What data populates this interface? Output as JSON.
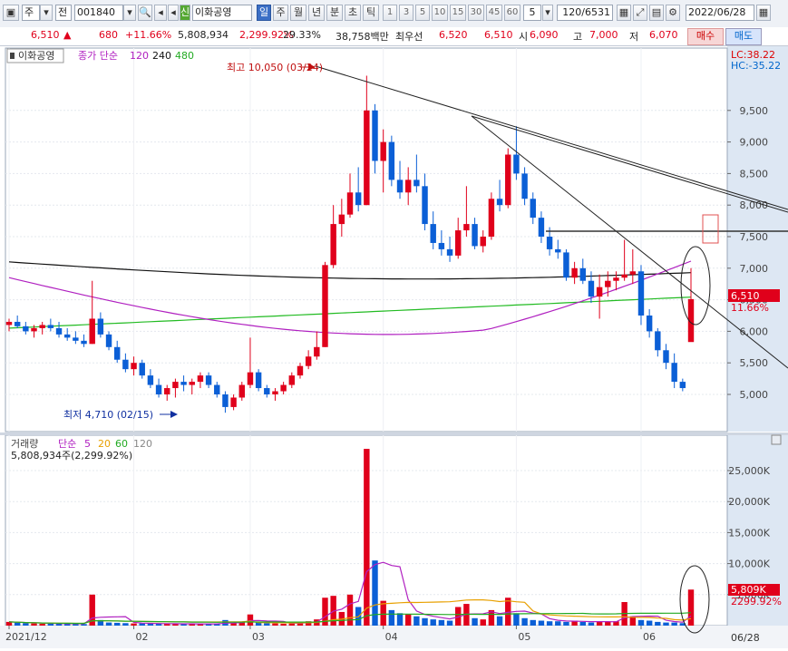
{
  "toolbar": {
    "market_label": "주",
    "jeon_label": "전",
    "code": "001840",
    "stock_badge": "신",
    "stock_name": "이화공영",
    "periods": [
      "일",
      "주",
      "월",
      "년",
      "분",
      "초",
      "틱"
    ],
    "active_period": "일",
    "intervals": [
      "1",
      "3",
      "5",
      "10",
      "15",
      "30",
      "45",
      "60"
    ],
    "interval_value": "5",
    "count": "120/6531",
    "date": "2022/06/28"
  },
  "quote": {
    "price": "6,510",
    "change": "680",
    "change_pct": "+11.66%",
    "volume": "5,808,934",
    "volume_ratio": "2,299.92%",
    "turnover": "29.33%",
    "amount": "38,758백만",
    "priority_label": "최우선",
    "priority_value": "6,520",
    "priority_value2": "6,510",
    "open_label": "시",
    "open": "6,090",
    "high_label": "고",
    "high": "7,000",
    "low_label": "저",
    "low": "6,070",
    "buy_label": "매수",
    "sell_label": "매도"
  },
  "price_panel": {
    "name_label": "이화공영",
    "ma_label": "종가 단순",
    "ma_periods": [
      "120",
      "240",
      "480"
    ],
    "lc": "LC:38.22",
    "hc": "HC:-35.22",
    "high_annotation": "최고 10,050 (03/24)",
    "low_annotation": "최저 4,710 (02/15)",
    "current_price_tag": "6,510",
    "current_pct_tag": "11.66%",
    "y_ticks": [
      "9,500",
      "9,000",
      "8,500",
      "8,000",
      "7,500",
      "7,000",
      "6,500",
      "6,000",
      "5,500",
      "5,000"
    ]
  },
  "volume_panel": {
    "label": "거래량",
    "ma_label": "단순",
    "ma_periods": [
      "5",
      "20",
      "60",
      "120"
    ],
    "today_volume": "5,808,934주(2,299.92%)",
    "volume_tag": "5,809K",
    "ratio_tag": "2299.92%",
    "y_ticks": [
      "25,000K",
      "20,000K",
      "15,000K",
      "10,000K",
      "5,000K"
    ]
  },
  "x_axis": {
    "labels": [
      "2021/12",
      "02",
      "03",
      "04",
      "05",
      "06"
    ],
    "last_date": "06/28"
  },
  "colors": {
    "up": "#e0001b",
    "down": "#0b5fd6",
    "ma120": "#b020c0",
    "ma240": "#22bb22",
    "ma480": "#111111",
    "vol_ma5": "#b020c0",
    "vol_ma20": "#e8a000",
    "vol_ma60": "#22aa22",
    "vol_ma120": "#888888"
  },
  "chart_data": {
    "type": "candlestick",
    "price_axis_range": [
      4500,
      10300
    ],
    "volume_axis_range": [
      0,
      29000
    ],
    "x_labels": [
      "2021/12",
      "02",
      "03",
      "04",
      "05",
      "06"
    ],
    "candles": [
      [
        6100,
        6200,
        6000,
        6150
      ],
      [
        6150,
        6250,
        6050,
        6080
      ],
      [
        6080,
        6150,
        5950,
        6000
      ],
      [
        6000,
        6100,
        5900,
        6050
      ],
      [
        6050,
        6150,
        5950,
        6100
      ],
      [
        6100,
        6200,
        6000,
        6050
      ],
      [
        6050,
        6150,
        5900,
        5950
      ],
      [
        5950,
        6050,
        5850,
        5900
      ],
      [
        5900,
        6000,
        5800,
        5850
      ],
      [
        5850,
        5950,
        5750,
        5800
      ],
      [
        5800,
        6800,
        5800,
        6200
      ],
      [
        6200,
        6300,
        5900,
        5950
      ],
      [
        5950,
        6000,
        5700,
        5750
      ],
      [
        5750,
        5850,
        5500,
        5550
      ],
      [
        5550,
        5650,
        5350,
        5400
      ],
      [
        5400,
        5600,
        5300,
        5500
      ],
      [
        5500,
        5550,
        5250,
        5300
      ],
      [
        5300,
        5400,
        5100,
        5150
      ],
      [
        5150,
        5250,
        4950,
        5000
      ],
      [
        5000,
        5150,
        4900,
        5100
      ],
      [
        5100,
        5250,
        4950,
        5200
      ],
      [
        5200,
        5300,
        5050,
        5150
      ],
      [
        5150,
        5250,
        5000,
        5200
      ],
      [
        5200,
        5350,
        5100,
        5300
      ],
      [
        5300,
        5350,
        5100,
        5150
      ],
      [
        5150,
        5200,
        4950,
        5000
      ],
      [
        5000,
        5050,
        4710,
        4800
      ],
      [
        4800,
        5000,
        4750,
        4950
      ],
      [
        4950,
        5200,
        4900,
        5150
      ],
      [
        5150,
        5900,
        5100,
        5350
      ],
      [
        5350,
        5400,
        5050,
        5100
      ],
      [
        5100,
        5150,
        4950,
        5000
      ],
      [
        5000,
        5100,
        4900,
        5050
      ],
      [
        5050,
        5200,
        5000,
        5150
      ],
      [
        5150,
        5350,
        5100,
        5300
      ],
      [
        5300,
        5500,
        5250,
        5450
      ],
      [
        5450,
        5700,
        5400,
        5600
      ],
      [
        5600,
        6000,
        5550,
        5750
      ],
      [
        5750,
        7100,
        5750,
        7050
      ],
      [
        7050,
        8000,
        7000,
        7700
      ],
      [
        7700,
        8100,
        7500,
        7850
      ],
      [
        7850,
        8500,
        7800,
        8200
      ],
      [
        8200,
        8600,
        7900,
        8000
      ],
      [
        8000,
        10050,
        8000,
        9500
      ],
      [
        9500,
        9600,
        8500,
        8700
      ],
      [
        8700,
        9200,
        8200,
        9000
      ],
      [
        9000,
        9100,
        8300,
        8400
      ],
      [
        8400,
        8700,
        8100,
        8200
      ],
      [
        8200,
        8600,
        8000,
        8400
      ],
      [
        8400,
        8800,
        8200,
        8300
      ],
      [
        8300,
        8500,
        7600,
        7700
      ],
      [
        7700,
        7900,
        7300,
        7400
      ],
      [
        7400,
        7600,
        7200,
        7300
      ],
      [
        7300,
        7500,
        7100,
        7200
      ],
      [
        7200,
        7800,
        7150,
        7600
      ],
      [
        7600,
        8300,
        7500,
        7700
      ],
      [
        7700,
        7800,
        7300,
        7350
      ],
      [
        7350,
        7600,
        7250,
        7500
      ],
      [
        7500,
        8200,
        7450,
        8100
      ],
      [
        8100,
        8400,
        7900,
        8000
      ],
      [
        8000,
        8900,
        7950,
        8800
      ],
      [
        8800,
        9250,
        8400,
        8500
      ],
      [
        8500,
        8600,
        8000,
        8100
      ],
      [
        8100,
        8200,
        7700,
        7800
      ],
      [
        7800,
        7900,
        7400,
        7500
      ],
      [
        7500,
        7650,
        7200,
        7300
      ],
      [
        7300,
        7450,
        7150,
        7250
      ],
      [
        7250,
        7300,
        6800,
        6850
      ],
      [
        6850,
        7100,
        6750,
        7000
      ],
      [
        7000,
        7150,
        6750,
        6800
      ],
      [
        6800,
        6950,
        6450,
        6550
      ],
      [
        6550,
        6900,
        6200,
        6700
      ],
      [
        6700,
        6950,
        6550,
        6800
      ],
      [
        6800,
        6950,
        6650,
        6850
      ],
      [
        6850,
        7450,
        6800,
        6900
      ],
      [
        6900,
        7300,
        6750,
        6950
      ],
      [
        6950,
        7050,
        6100,
        6250
      ],
      [
        6250,
        6350,
        5900,
        6000
      ],
      [
        6000,
        6050,
        5600,
        5700
      ],
      [
        5700,
        5800,
        5400,
        5500
      ],
      [
        5500,
        5650,
        5100,
        5200
      ],
      [
        5200,
        5250,
        5050,
        5100
      ],
      [
        5830,
        7000,
        6070,
        6510
      ]
    ],
    "volume": [
      600,
      500,
      400,
      350,
      300,
      300,
      350,
      250,
      300,
      250,
      5000,
      900,
      500,
      450,
      400,
      350,
      350,
      300,
      300,
      300,
      280,
      300,
      250,
      260,
      280,
      300,
      900,
      400,
      600,
      1800,
      500,
      400,
      350,
      300,
      350,
      600,
      700,
      1000,
      4500,
      4800,
      2200,
      5000,
      3000,
      28500,
      10500,
      4000,
      2500,
      2000,
      1800,
      1500,
      1200,
      1000,
      900,
      800,
      3000,
      3500,
      1200,
      1000,
      2500,
      1500,
      4500,
      2000,
      1200,
      900,
      800,
      700,
      700,
      600,
      800,
      600,
      500,
      700,
      600,
      700,
      3800,
      1500,
      900,
      800,
      600,
      500,
      500,
      400,
      5809
    ]
  }
}
